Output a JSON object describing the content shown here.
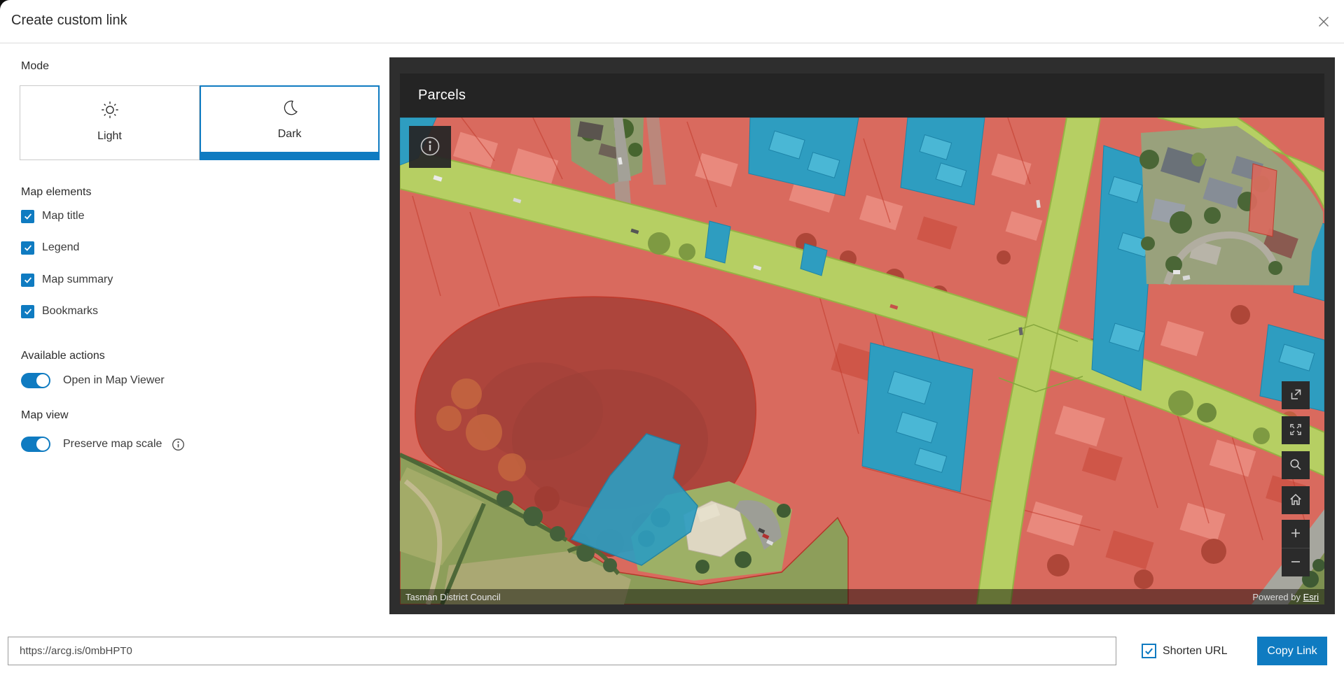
{
  "dialog": {
    "title": "Create custom link"
  },
  "mode": {
    "label": "Mode",
    "options": [
      {
        "label": "Light",
        "icon": "sun-icon",
        "selected": false
      },
      {
        "label": "Dark",
        "icon": "moon-icon",
        "selected": true
      }
    ]
  },
  "map_elements": {
    "label": "Map elements",
    "items": [
      {
        "label": "Map title",
        "checked": true
      },
      {
        "label": "Legend",
        "checked": true
      },
      {
        "label": "Map summary",
        "checked": true
      },
      {
        "label": "Bookmarks",
        "checked": true
      }
    ]
  },
  "available_actions": {
    "label": "Available actions",
    "items": [
      {
        "label": "Open in Map Viewer",
        "enabled": true
      }
    ]
  },
  "map_view": {
    "label": "Map view",
    "items": [
      {
        "label": "Preserve map scale",
        "enabled": true,
        "has_info_icon": true
      }
    ]
  },
  "preview": {
    "map_title": "Parcels",
    "attribution_left": "Tasman District Council",
    "attribution_right_prefix": "Powered by ",
    "attribution_link": "Esri",
    "controls": [
      "open-in-new-icon",
      "expand-icon",
      "search-icon",
      "home-icon",
      "zoom-in-icon",
      "zoom-out-icon"
    ],
    "overlay_legend_colors": {
      "parcel_red": "#d96a5e",
      "parcel_blue": "#2e9dc0",
      "road_green": "#b6cf63",
      "pond_dark_red": "#ad453c"
    },
    "panel_background": "#2e2e2e",
    "header_background": "#242424"
  },
  "footer": {
    "url_value": "https://arcg.is/0mbHPT0",
    "shorten_label": "Shorten URL",
    "shorten_checked": true,
    "copy_button": "Copy Link"
  },
  "colors": {
    "accent": "#0f7bc1"
  }
}
